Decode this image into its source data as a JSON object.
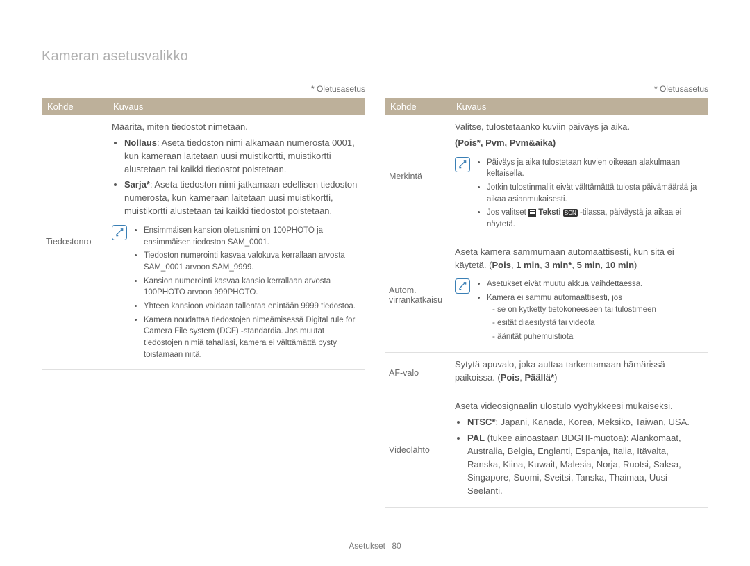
{
  "title": "Kameran asetusvalikko",
  "default_label": "* Oletusasetus",
  "headers": {
    "kohde": "Kohde",
    "kuvaus": "Kuvaus"
  },
  "footer": {
    "section": "Asetukset",
    "page": "80"
  },
  "left": {
    "rows": [
      {
        "kohde": "Tiedostonro",
        "intro": "Määritä, miten tiedostot nimetään.",
        "bullets": [
          {
            "b": "Nollaus",
            "text": ": Aseta tiedoston nimi alkamaan numerosta 0001, kun kameraan laitetaan uusi muistikortti, muistikortti alustetaan tai kaikki tiedostot poistetaan."
          },
          {
            "b": "Sarja*",
            "text": ": Aseta tiedoston nimi jatkamaan edellisen tiedoston numerosta, kun kameraan laitetaan uusi muistikortti, muistikortti alustetaan tai kaikki tiedostot poistetaan."
          }
        ],
        "note": [
          "Ensimmäisen kansion oletusnimi on 100PHOTO ja ensimmäisen tiedoston SAM_0001.",
          "Tiedoston numerointi kasvaa valokuva kerrallaan arvosta SAM_0001 arvoon SAM_9999.",
          "Kansion numerointi kasvaa kansio kerrallaan arvosta 100PHOTO arvoon 999PHOTO.",
          "Yhteen kansioon voidaan tallentaa enintään 9999 tiedostoa.",
          "Kamera noudattaa tiedostojen nimeämisessä Digital rule for Camera File system (DCF) -standardia. Jos muutat tiedostojen nimiä tahallasi, kamera ei välttämättä pysty toistamaan niitä."
        ]
      }
    ]
  },
  "right": {
    "rows": [
      {
        "kohde": "Merkintä",
        "intro": "Valitse, tulostetaanko kuviin päiväys ja aika.",
        "options": "Pois*, Pvm, Pvm&aika",
        "note": [
          "Päiväys ja aika tulostetaan kuvien oikeaan alakulmaan keltaisella.",
          "Jotkin tulostinmallit eivät välttämättä tulosta päivämäärää ja aikaa asianmukaisesti.",
          "Jos valitset __TEKSTI__ -tilassa, päiväystä ja aikaa ei näytetä."
        ]
      },
      {
        "kohde": "Autom. virrankatkaisu",
        "intro_html": "Aseta kamera sammumaan automaattisesti, kun sitä ei käytetä. (<b>Pois</b>, <b>1 min</b>, <b>3 min*</b>, <b>5 min</b>, <b>10 min</b>)",
        "note_lead": "Asetukset eivät muutu akkua vaihdettaessa.",
        "note_intro": "Kamera ei sammu automaattisesti, jos",
        "note_sub": [
          "se on kytketty tietokoneeseen tai tulostimeen",
          "esität diaesitystä tai videota",
          "äänität puhemuistiota"
        ]
      },
      {
        "kohde": "AF-valo",
        "intro_html": "Sytytä apuvalo, joka auttaa tarkentamaan hämärissä paikoissa. (<b>Pois</b>, <b>Päällä*</b>)"
      },
      {
        "kohde": "Videolähtö",
        "intro": "Aseta videosignaalin ulostulo vyöhykkeesi mukaiseksi.",
        "bullets": [
          {
            "b": "NTSC*",
            "text": ": Japani, Kanada, Korea, Meksiko, Taiwan, USA."
          },
          {
            "b": "PAL",
            "tail": " (tukee ainoastaan BDGHI-muotoa):",
            "text2": " Alankomaat, Australia, Belgia, Englanti, Espanja, Italia, Itävalta, Ranska, Kiina, Kuwait, Malesia, Norja, Ruotsi, Saksa, Singapore, Suomi, Sveitsi, Tanska, Thaimaa, Uusi-Seelanti."
          }
        ]
      }
    ]
  }
}
